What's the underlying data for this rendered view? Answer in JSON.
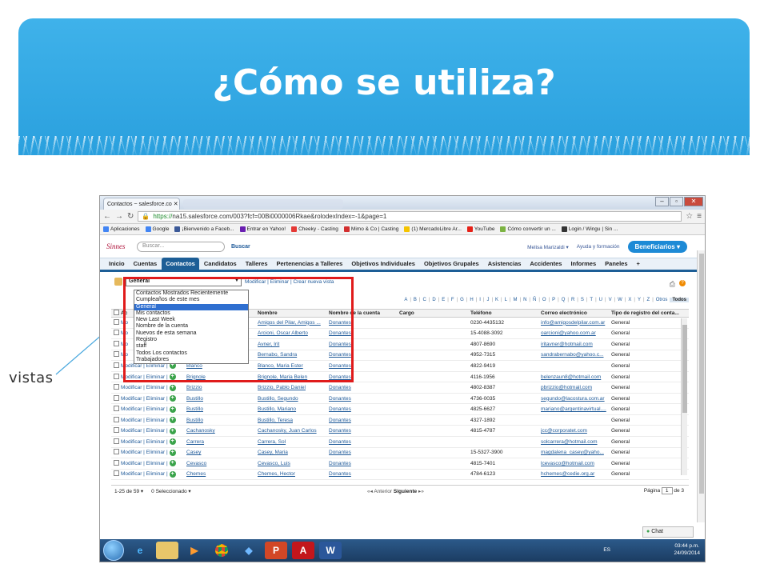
{
  "slide": {
    "title": "¿Cómo se utiliza?",
    "side_label": "vistas"
  },
  "browser": {
    "tab_title": "Contactos ~ salesforce.co",
    "url_https": "https://",
    "url_rest": "na15.salesforce.com/003?fcf=00Bi0000006Rkae&rolodexIndex=-1&page=1",
    "bookmarks": [
      "Aplicaciones",
      "Google",
      "¡Bienvenido a Faceb...",
      "Entrar en Yahoo!",
      "Cheeky - Casting",
      "Mimo & Co | Casting",
      "(1) MercadoLibre Ar...",
      "YouTube",
      "Cómo convertir un ...",
      "Login / Wingu | Sin ..."
    ]
  },
  "sf": {
    "logo": "Sinnes",
    "search_placeholder": "Buscar...",
    "search_button": "Buscar",
    "user": "Melisa Marizaldi",
    "help": "Ayuda y formación",
    "app": "Beneficiarios",
    "tabs": [
      "Inicio",
      "Cuentas",
      "Contactos",
      "Candidatos",
      "Talleres",
      "Pertenencias a Talleres",
      "Objetivos Individuales",
      "Objetivos Grupales",
      "Asistencias",
      "Accidentes",
      "Informes",
      "Paneles",
      "+"
    ],
    "active_tab_index": 2
  },
  "view": {
    "selected": "General",
    "links": "Modificar | Eliminar | Crear nueva vista",
    "options": [
      "Contactos Mostrados Recientemente",
      "Cumpleaños de este mes",
      "General",
      "Mis contactos",
      "New Last Week",
      "Nombre de la cuenta",
      "Nuevos de esta semana",
      "Registro",
      "staff",
      "Todos Los contactos",
      "Trabajadores"
    ],
    "selected_option_index": 2
  },
  "alphabet": [
    "A",
    "B",
    "C",
    "D",
    "E",
    "F",
    "G",
    "H",
    "I",
    "J",
    "K",
    "L",
    "M",
    "N",
    "Ñ",
    "O",
    "P",
    "Q",
    "R",
    "S",
    "T",
    "U",
    "V",
    "W",
    "X",
    "Y",
    "Z",
    "Otros",
    "Todos"
  ],
  "grid": {
    "headers": [
      "Ac",
      "",
      "Nombre",
      "Nombre de la cuenta",
      "Cargo",
      "Teléfono",
      "Correo electrónico",
      "Tipo de registro del conta..."
    ],
    "rows": [
      {
        "action": "Mo",
        "ap": "",
        "nom": "Amigos del Pilar, Amigos ...",
        "cta": "Donantes",
        "tel": "0230-4435132",
        "mail": "info@amigosdelpilar.com.ar",
        "tipo": "General"
      },
      {
        "action": "Mo",
        "ap": "",
        "nom": "Arcioni, Oscar Alberto",
        "cta": "Donantes",
        "tel": "15-4088-3092",
        "mail": "oarcioni@yahoo.com.ar",
        "tipo": "General"
      },
      {
        "action": "Mo",
        "ap": "",
        "nom": "Avner, Irit",
        "cta": "Donantes",
        "tel": "4807-8690",
        "mail": "iritavner@hotmail.com",
        "tipo": "General"
      },
      {
        "action": "Mo",
        "ap": "",
        "nom": "Bernabo, Sandra",
        "cta": "Donantes",
        "tel": "4952-7315",
        "mail": "sandrabernabo@yahoo.c...",
        "tipo": "General"
      },
      {
        "action": "Modificar | Eliminar |",
        "ap": "Blanco",
        "nom": "Blanco, Maria Ester",
        "cta": "Donantes",
        "tel": "4822-9419",
        "mail": "",
        "tipo": "General"
      },
      {
        "action": "Modificar | Eliminar |",
        "ap": "Brignole",
        "nom": "Brignole, Maria Belen",
        "cta": "Donantes",
        "tel": "4116-1956",
        "mail": "belenzaun8@hotmail.com",
        "tipo": "General"
      },
      {
        "action": "Modificar | Eliminar |",
        "ap": "Brizzio",
        "nom": "Brizzio, Pablo Daniel",
        "cta": "Donantes",
        "tel": "4802-8387",
        "mail": "pbrizzio@hotmail.com",
        "tipo": "General"
      },
      {
        "action": "Modificar | Eliminar |",
        "ap": "Bustillo",
        "nom": "Bustillo, Segundo",
        "cta": "Donantes",
        "tel": "4736-0035",
        "mail": "segundo@lacostura.com.ar",
        "tipo": "General"
      },
      {
        "action": "Modificar | Eliminar |",
        "ap": "Bustillo",
        "nom": "Bustillo, Mariano",
        "cta": "Donantes",
        "tel": "4825-6627",
        "mail": "mariano@argentinavirtual....",
        "tipo": "General"
      },
      {
        "action": "Modificar | Eliminar |",
        "ap": "Bustillo",
        "nom": "Bustillo, Teresa",
        "cta": "Donantes",
        "tel": "4327-1892",
        "mail": "",
        "tipo": "General"
      },
      {
        "action": "Modificar | Eliminar |",
        "ap": "Cachanosky",
        "nom": "Cachanosky, Juan Carlos",
        "cta": "Donantes",
        "tel": "4815-4787",
        "mail": "jcc@corporatet.com",
        "tipo": "General"
      },
      {
        "action": "Modificar | Eliminar |",
        "ap": "Carrera",
        "nom": "Carrera, Sol",
        "cta": "Donantes",
        "tel": "",
        "mail": "solcarrera@hotmail.com",
        "tipo": "General"
      },
      {
        "action": "Modificar | Eliminar |",
        "ap": "Casey",
        "nom": "Casey, Maria",
        "cta": "Donantes",
        "tel": "15-5327-3900",
        "mail": "magdalena_casey@yaho...",
        "tipo": "General"
      },
      {
        "action": "Modificar | Eliminar |",
        "ap": "Cevasco",
        "nom": "Cevasco, Luis",
        "cta": "Donantes",
        "tel": "4815-7401",
        "mail": "lcevasco@hotmail.com",
        "tipo": "General"
      },
      {
        "action": "Modificar | Eliminar |",
        "ap": "Chemes",
        "nom": "Chemes, Hector",
        "cta": "Donantes",
        "tel": "4784-6123",
        "mail": "hchemes@cedie.org.ar",
        "tipo": "General"
      }
    ]
  },
  "footer": {
    "range": "1-25 de 59",
    "selected": "0 Seleccionado",
    "prev": "Anterior",
    "next": "Siguiente",
    "page_label": "Página",
    "page_value": "1",
    "page_total": "de 3",
    "chat": "Chat"
  },
  "taskbar": {
    "lang": "ES",
    "time": "03:44 p.m.",
    "date": "24/09/2014"
  },
  "colors": {
    "band": "#2aa0de",
    "highlight_box": "#e01b1b",
    "sf_nav": "#1d5e96"
  }
}
